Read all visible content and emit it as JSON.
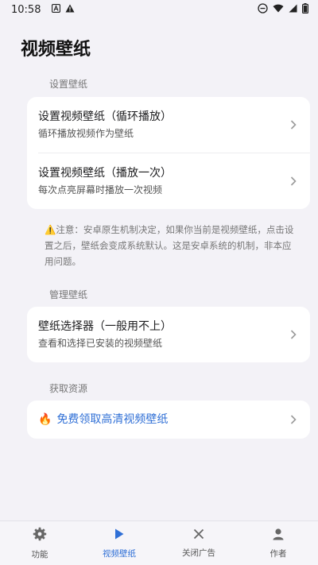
{
  "status": {
    "time": "10:58",
    "left_icons": [
      "notification-a-icon",
      "warning-icon"
    ],
    "right_icons": [
      "do-not-disturb-icon",
      "wifi-icon",
      "signal-icon",
      "battery-icon"
    ]
  },
  "page": {
    "title": "视频壁纸"
  },
  "sections": {
    "setup_label": "设置壁纸",
    "manage_label": "管理壁纸",
    "resources_label": "获取资源"
  },
  "setup": {
    "loop": {
      "title": "设置视频壁纸（循环播放）",
      "sub": "循环播放视频作为壁纸"
    },
    "once": {
      "title": "设置视频壁纸（播放一次）",
      "sub": "每次点亮屏幕时播放一次视频"
    }
  },
  "note": {
    "emoji": "⚠️",
    "text": "注意：安卓原生机制决定，如果你当前是视频壁纸，点击设置之后，壁纸会变成系统默认。这是安卓系统的机制，非本应用问题。"
  },
  "manage": {
    "picker": {
      "title": "壁纸选择器（一般用不上）",
      "sub": "查看和选择已安装的视频壁纸"
    }
  },
  "resources": {
    "free": {
      "emoji": "🔥",
      "title": "免费领取高清视频壁纸"
    }
  },
  "tabs": [
    {
      "label": "功能",
      "icon": "gear-icon"
    },
    {
      "label": "视频壁纸",
      "icon": "play-icon"
    },
    {
      "label": "关闭广告",
      "icon": "close-icon"
    },
    {
      "label": "作者",
      "icon": "person-icon"
    }
  ],
  "colors": {
    "accent": "#2f6fd6",
    "background": "#f3f2f7",
    "card": "#ffffff"
  }
}
